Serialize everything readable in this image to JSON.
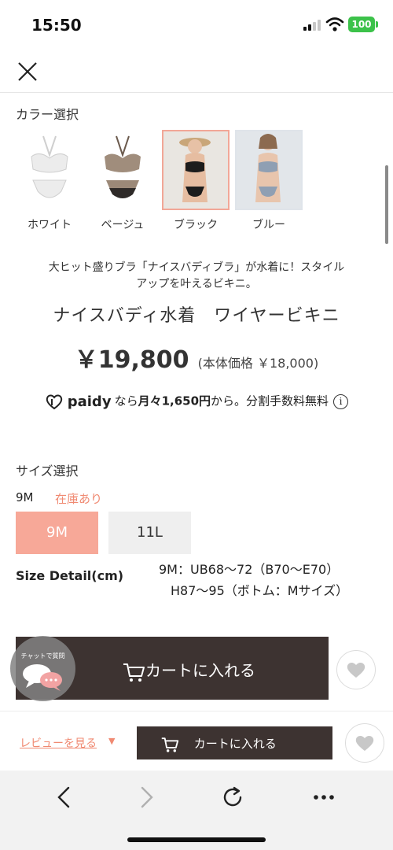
{
  "status_bar": {
    "time": "15:50",
    "battery": "100"
  },
  "color_section": {
    "label": "カラー選択",
    "options": [
      {
        "label": "ホワイト",
        "selected": false
      },
      {
        "label": "ベージュ",
        "selected": false
      },
      {
        "label": "ブラック",
        "selected": true
      },
      {
        "label": "ブルー",
        "selected": false
      }
    ]
  },
  "product": {
    "catch_line1": "大ヒット盛りブラ「ナイスバディブラ」が水着に！スタイル",
    "catch_line2": "アップを叶えるビキニ。",
    "title": "ナイスバディ水着　ワイヤービキニ",
    "price": "￥19,800",
    "price_note": "(本体価格 ￥18,000)"
  },
  "paidy": {
    "brand": "paidy",
    "text_before": "なら",
    "amount": "月々1,650円",
    "text_after": "から。分割手数料無料",
    "info": "i"
  },
  "size_section": {
    "label": "サイズ選択",
    "selected_size": "9M",
    "stock": "在庫あり",
    "options": [
      {
        "label": "9M",
        "active": true
      },
      {
        "label": "11L",
        "active": false
      }
    ],
    "detail_label": "Size Detail(cm)",
    "detail_line1": "9M：UB68〜72（B70〜E70）",
    "detail_line2": "H87〜95（ボトム：Mサイズ）"
  },
  "cart": {
    "main_label": "カートに入れる",
    "bottom_label": "カートに入れる"
  },
  "chat": {
    "label": "チャットで質問"
  },
  "bottom_bar": {
    "review_link": "レビューを見る",
    "review_arrow": "▼"
  },
  "colors": {
    "accent": "#f7a898",
    "stock": "#f08a72",
    "cart_bg": "#3d3331",
    "battery": "#3cc24a"
  },
  "icons": [
    "close-icon",
    "heart-icon",
    "cart-icon",
    "chat-icon",
    "info-icon",
    "back-icon",
    "forward-icon",
    "reload-icon",
    "more-icon"
  ]
}
